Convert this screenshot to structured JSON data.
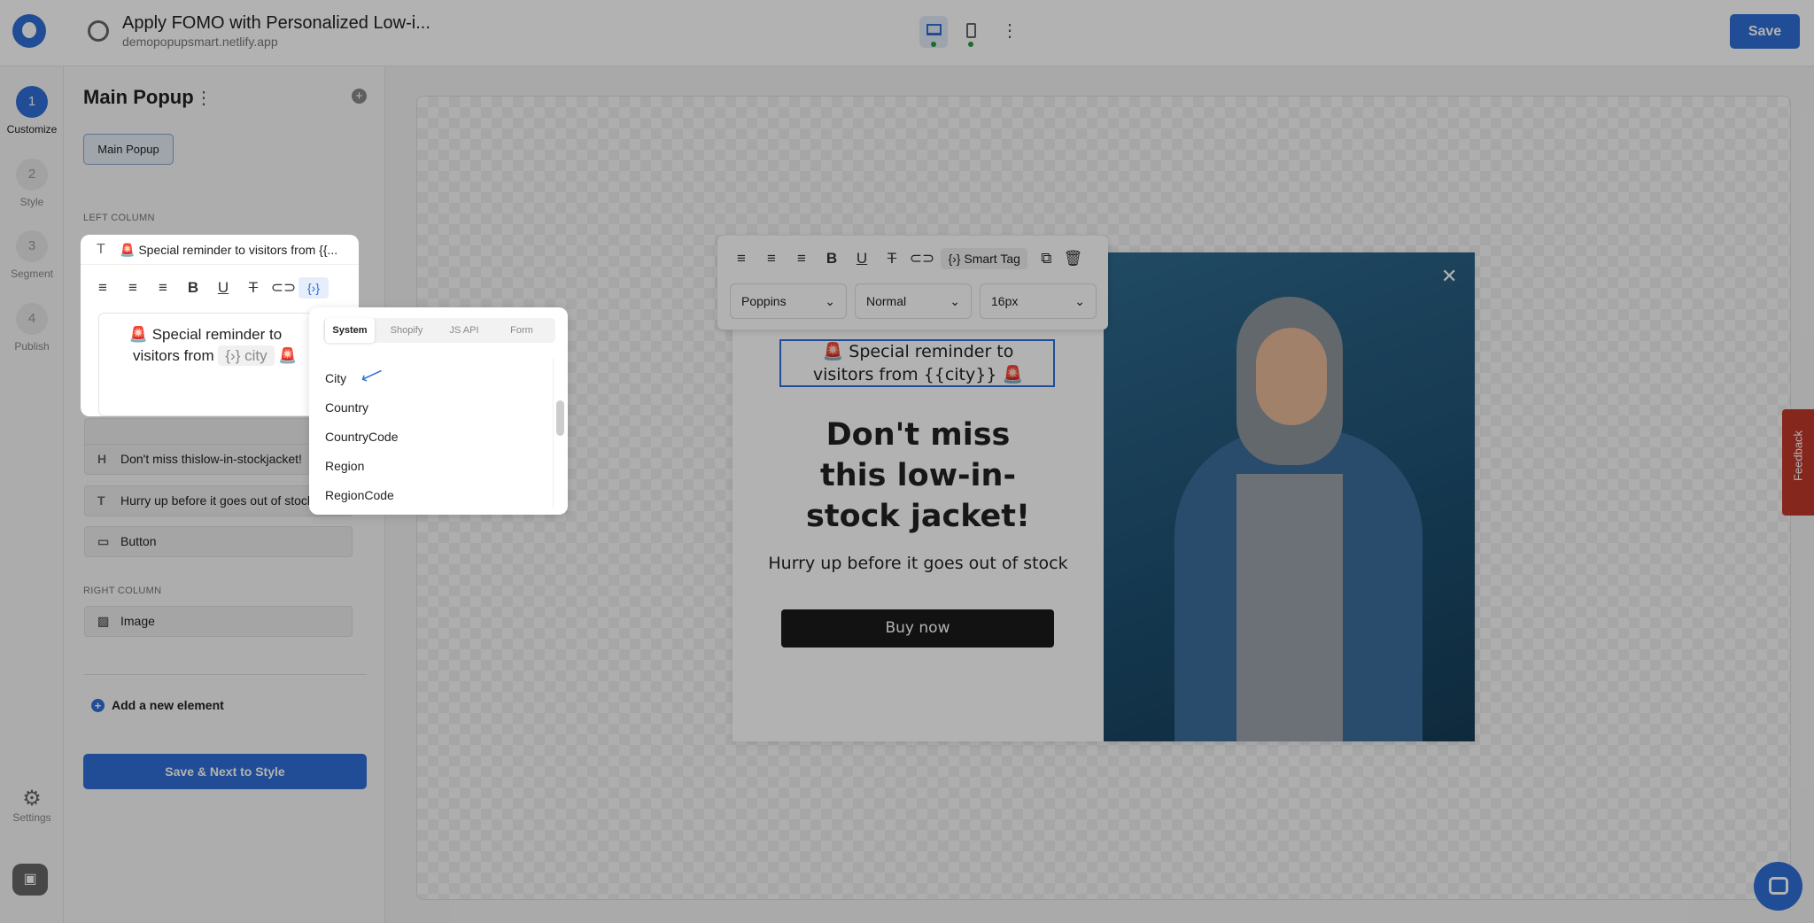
{
  "header": {
    "title": "Apply FOMO with Personalized Low-i...",
    "subtitle": "demopopupsmart.netlify.app",
    "save_label": "Save"
  },
  "steps": [
    {
      "num": "1",
      "label": "Customize"
    },
    {
      "num": "2",
      "label": "Style"
    },
    {
      "num": "3",
      "label": "Segment"
    },
    {
      "num": "4",
      "label": "Publish"
    }
  ],
  "rail": {
    "settings_label": "Settings"
  },
  "panel": {
    "title": "Main Popup",
    "chip": "Main Popup",
    "left_column": "LEFT COLUMN",
    "right_column": "RIGHT COLUMN",
    "selected_item": "🚨 Special reminder to visitors from {{...",
    "editor_line1": "🚨 Special reminder to",
    "editor_line2": "visitors from",
    "editor_tag": "city",
    "editor_emoji": "🚨",
    "items": [
      {
        "icon": "H",
        "label": "Don't miss thislow-in-stockjacket!"
      },
      {
        "icon": "T",
        "label": "Hurry up before it goes out of stock"
      },
      {
        "icon": "▭",
        "label": "Button"
      }
    ],
    "right_items": [
      {
        "icon": "▨",
        "label": "Image"
      }
    ],
    "add_label": "Add a new element",
    "next_label": "Save & Next to Style"
  },
  "smart_tag_menu": {
    "tabs": [
      "System",
      "Shopify",
      "JS API",
      "Form"
    ],
    "active_tab": "System",
    "items": [
      "City",
      "Country",
      "CountryCode",
      "Region",
      "RegionCode"
    ]
  },
  "toolbar": {
    "smart_tag": "Smart Tag",
    "font": "Poppins",
    "weight": "Normal",
    "size": "16px"
  },
  "popup": {
    "line1": "🚨 Special reminder to",
    "line2": "visitors from {{city}} 🚨",
    "headline": "Don't miss this low-in-stock jacket!",
    "sub": "Hurry up before it goes out of stock",
    "button": "Buy now"
  },
  "feedback": "Feedback",
  "colors": {
    "accent": "#2f6fd6",
    "button_dark": "#1a1a1a"
  }
}
